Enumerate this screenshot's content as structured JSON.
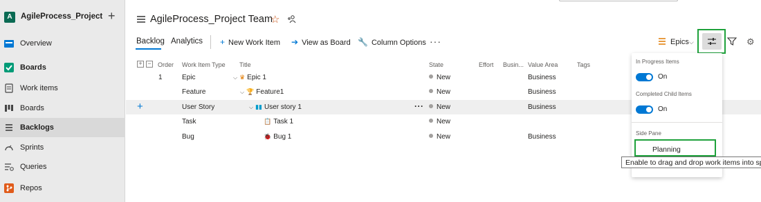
{
  "sidebar": {
    "project_initial": "A",
    "project_name": "AgileProcess_Project",
    "add_label": "+",
    "items": [
      {
        "label": "Overview"
      },
      {
        "label": "Boards"
      },
      {
        "label": "Work items"
      },
      {
        "label": "Boards"
      },
      {
        "label": "Backlogs"
      },
      {
        "label": "Sprints"
      },
      {
        "label": "Queries"
      },
      {
        "label": "Repos"
      }
    ]
  },
  "header": {
    "team_title": "AgileProcess_Project Team",
    "chevron": "⌵",
    "star": "☆"
  },
  "toolbar": {
    "tabs": [
      {
        "label": "Backlog"
      },
      {
        "label": "Analytics"
      }
    ],
    "new_work_item": "New Work Item",
    "view_as_board": "View as Board",
    "column_options": "Column Options",
    "more": "···",
    "level_selector": "Epics"
  },
  "grid": {
    "columns": [
      "Order",
      "Work Item Type",
      "Title",
      "State",
      "Effort",
      "Busin...",
      "Value Area",
      "Tags"
    ],
    "rows": [
      {
        "order": "1",
        "type": "Epic",
        "title": "Epic 1",
        "state": "New",
        "value_area": "Business"
      },
      {
        "order": "",
        "type": "Feature",
        "title": "Feature1",
        "state": "New",
        "value_area": "Business"
      },
      {
        "order": "",
        "type": "User Story",
        "title": "User story 1",
        "state": "New",
        "value_area": "Business"
      },
      {
        "order": "",
        "type": "Task",
        "title": "Task 1",
        "state": "New",
        "value_area": ""
      },
      {
        "order": "",
        "type": "Bug",
        "title": "Bug 1",
        "state": "New",
        "value_area": "Business"
      }
    ],
    "row_more": "···"
  },
  "view_options": {
    "in_progress_label": "In Progress Items",
    "in_progress_value": "On",
    "completed_child_label": "Completed Child Items",
    "completed_child_value": "On",
    "side_pane_label": "Side Pane",
    "planning_label": "Planning",
    "tooltip": "Enable to drag and drop work items into sprints"
  },
  "colors": {
    "accent": "#0078d4",
    "highlight_box": "#1ea13b",
    "epic_icon": "#e07a00",
    "feature_icon": "#773b93",
    "story_icon": "#009ccc",
    "task_icon": "#f2cb1d",
    "bug_icon": "#cc293d"
  }
}
